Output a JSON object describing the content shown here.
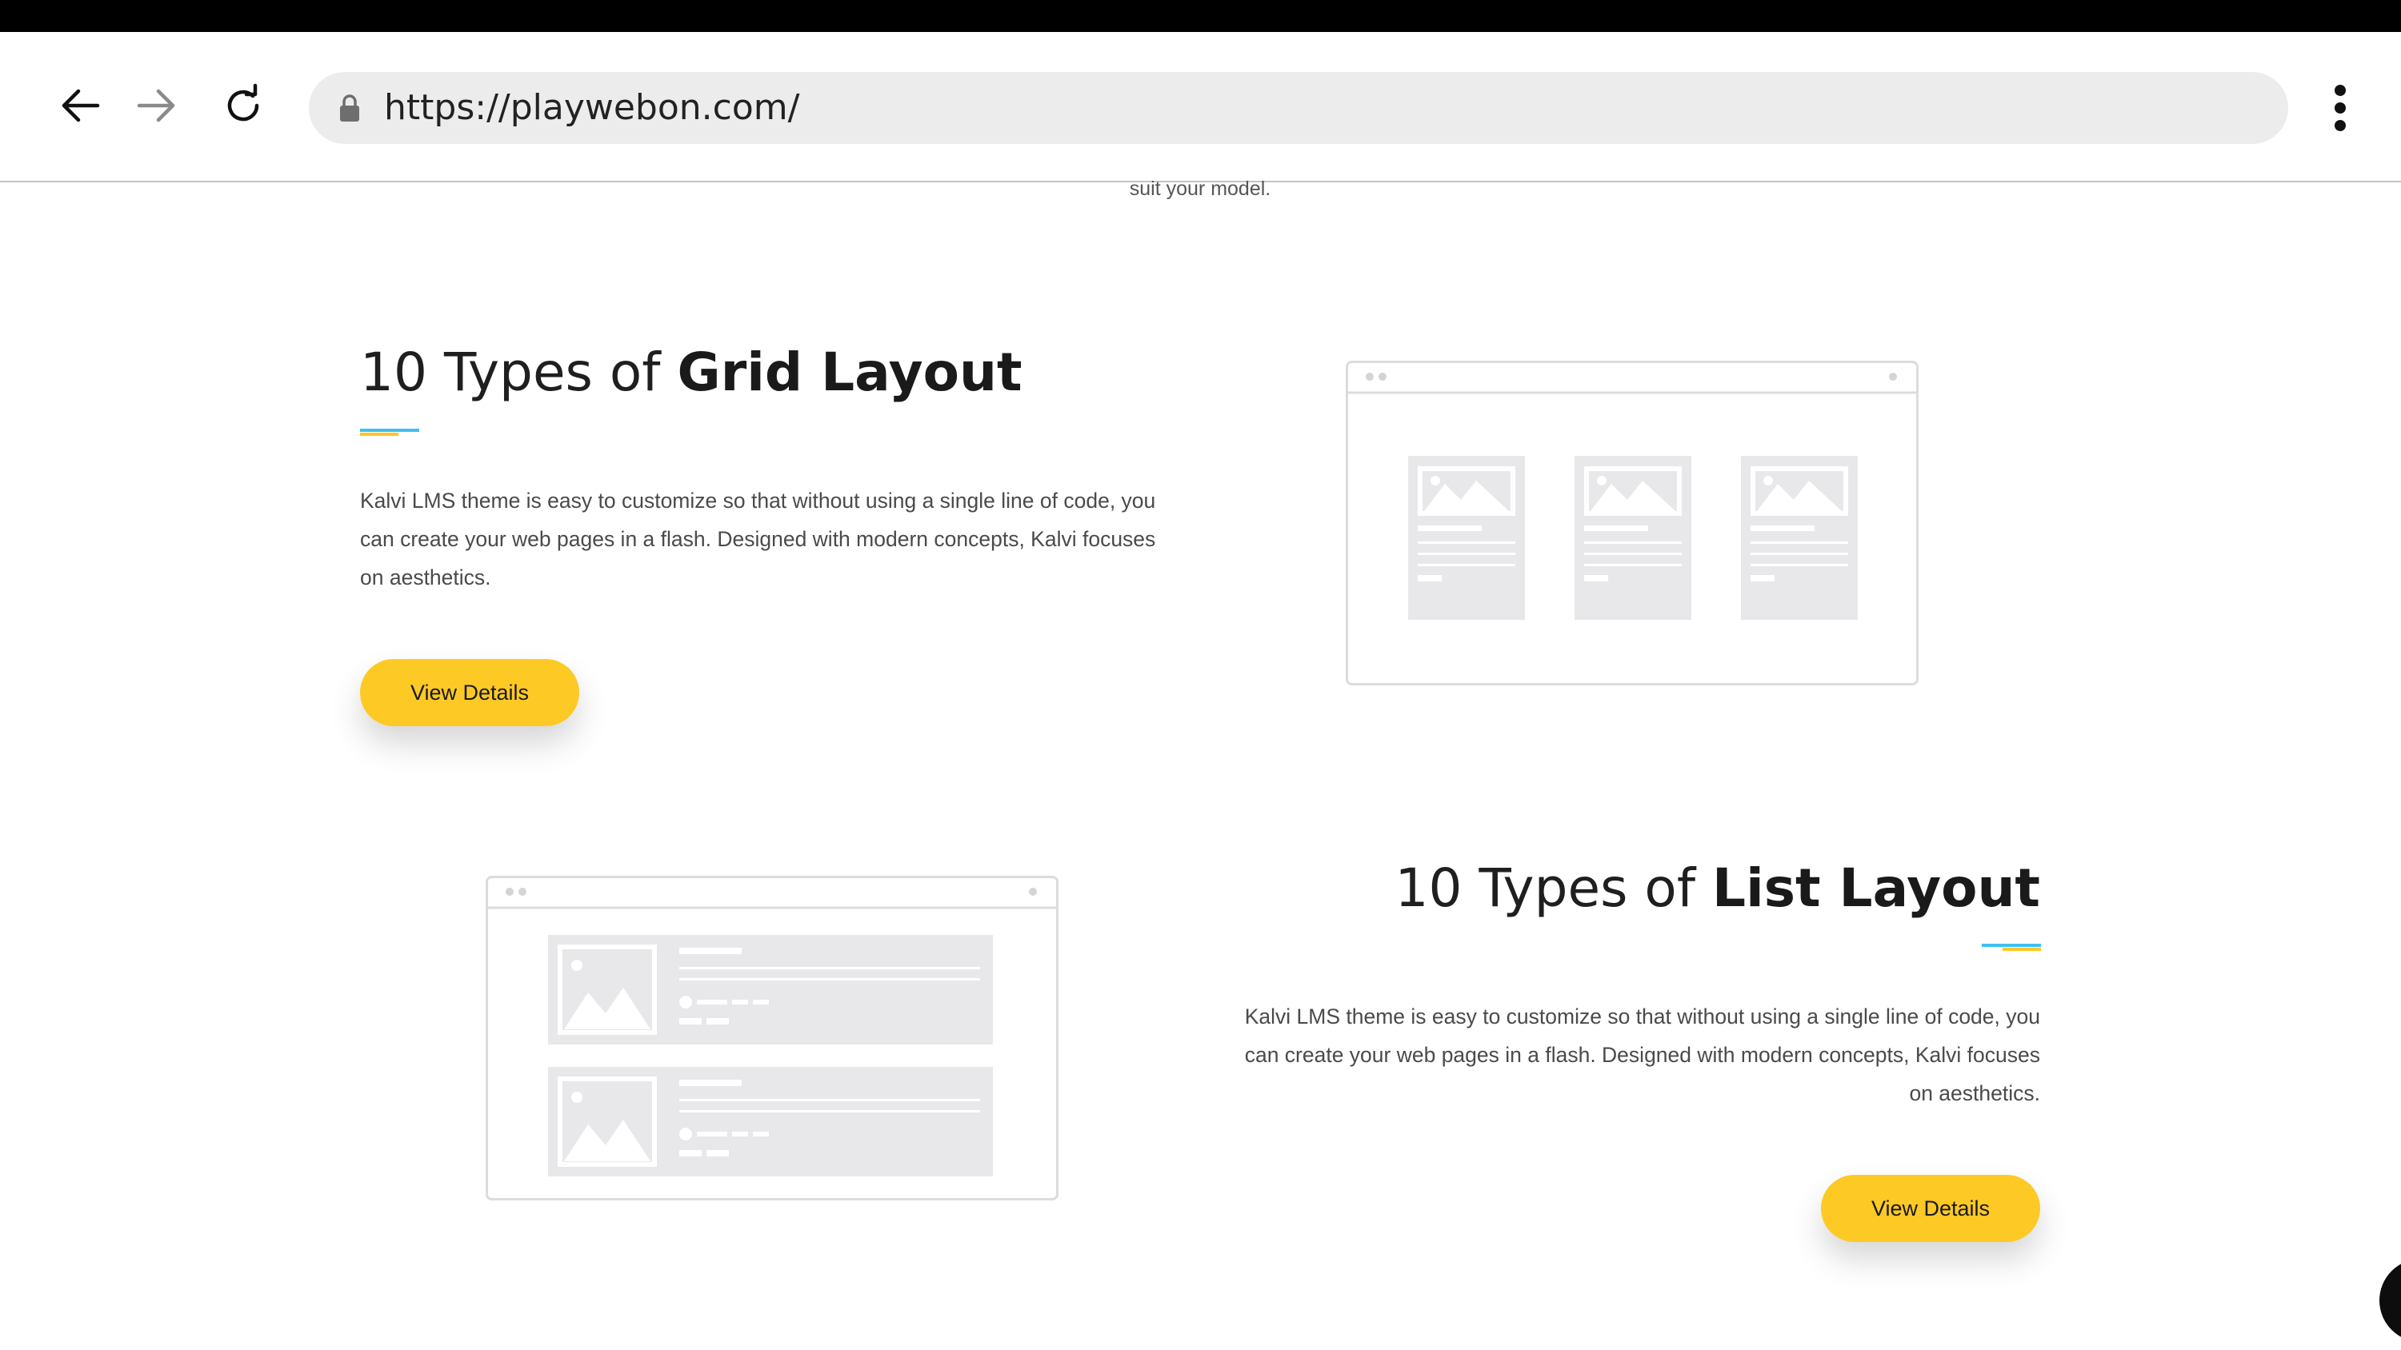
{
  "browser": {
    "url": "https://playwebon.com/",
    "icons": [
      "arrow-back-icon",
      "arrow-forward-icon",
      "reload-icon",
      "lock-icon",
      "more-vert-icon"
    ]
  },
  "page": {
    "top_fragment": "suit your model.",
    "sections": [
      {
        "heading_prefix": "10 Types of ",
        "heading_bold": "Grid Layout",
        "description": "Kalvi LMS theme is easy to customize so that without using a single line of code, you can create your web pages in a flash. Designed with modern concepts, Kalvi focuses on aesthetics.",
        "button_label": "View Details"
      },
      {
        "heading_prefix": "10 Types of ",
        "heading_bold": "List Layout",
        "description": "Kalvi LMS theme is easy to customize so that without using a single line of code, you can create your web pages in a flash. Designed with modern concepts, Kalvi focuses on aesthetics.",
        "button_label": "View Details"
      }
    ]
  },
  "colors": {
    "accent_yellow": "#fdc925",
    "accent_blue": "#3ec0f0",
    "heading": "#1f1f1f",
    "body_text": "#4a4a4a",
    "illustration_gray": "#e8e8ea"
  }
}
